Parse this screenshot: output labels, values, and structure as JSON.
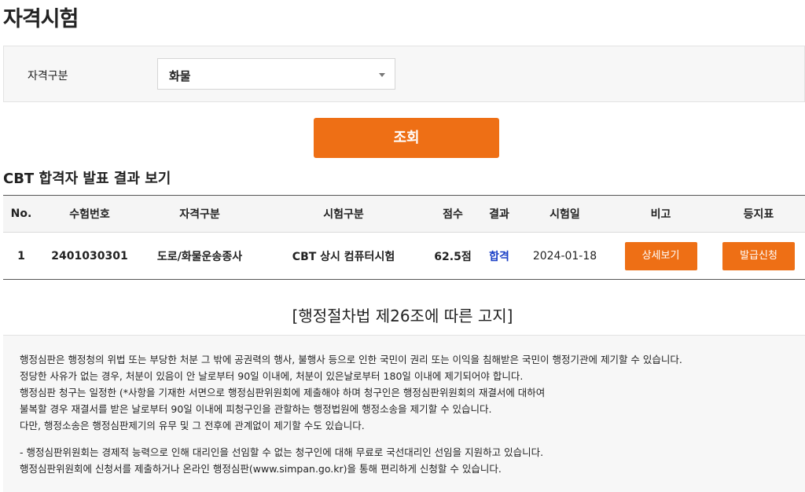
{
  "page": {
    "title": "자격시험"
  },
  "filter": {
    "label": "자격구분",
    "selected": "화물"
  },
  "search_button": "조회",
  "results": {
    "title": "CBT 합격자 발표 결과 보기",
    "headers": [
      "No.",
      "수험번호",
      "자격구분",
      "시험구분",
      "점수",
      "결과",
      "시험일",
      "비고",
      "등지표"
    ],
    "rows": [
      {
        "no": "1",
        "exam_number": "2401030301",
        "qualification": "도로/화물운송종사",
        "exam_type": "CBT 상시 컴퓨터시험",
        "score": "62.5점",
        "result": "합격",
        "date": "2024-01-18",
        "detail_button": "상세보기",
        "issue_button": "발급신청"
      }
    ]
  },
  "notice": {
    "title": "[행정절차법 제26조에 따른 고지]",
    "lines": [
      "행정심판은 행정청의 위법 또는 부당한 처분 그 밖에 공권력의 행사, 불행사 등으로 인한 국민이 권리 또는 이익을 침해받은 국민이 행정기관에 제기할 수 있습니다.",
      "정당한 사유가 없는 경우, 처분이 있음이 안 날로부터 90일 이내에, 처분이 있은날로부터 180일 이내에 제기되어야 합니다.",
      "행정심판 청구는 일정한 (*사항을 기재한 서면으로 행정심판위원회에 제출해야 하며 청구인은 행정심판위원회의 재결서에 대하여",
      "불복할 경우 재결서를 받은 날로부터 90일 이내에 피청구인을 관할하는 행정법원에 행정소송을 제기할 수 있습니다.",
      "다만, 행정소송은 행정심판제기의 유무 및 그 전후에 관계없이 제기할 수도 있습니다.",
      "- 행정심판위원회는 경제적 능력으로 인해 대리인을 선임할 수 없는 청구인에 대해 무료로 국선대리인 선임을 지원하고 있습니다.",
      "행정심판위원회에 신청서를 제출하거나 온라인 행정심판(www.simpan.go.kr)을 통해 편리하게 신청할 수 있습니다."
    ]
  },
  "colors": {
    "accent": "#ee6f15",
    "pass": "#1a3fc6"
  }
}
